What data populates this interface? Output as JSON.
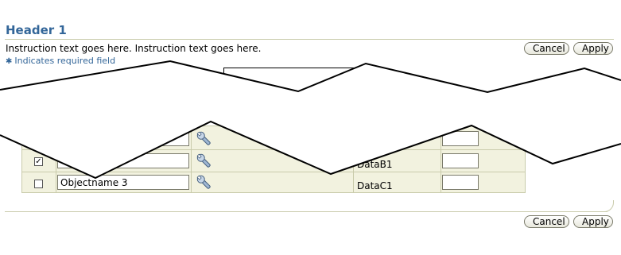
{
  "header": {
    "title": "Header 1",
    "instruction": "Instruction text goes here. Instruction text goes here.",
    "required_star": "✱",
    "required_text": "Indicates required field"
  },
  "buttons": {
    "cancel": "Cancel",
    "apply": "Apply"
  },
  "table": {
    "rows": [
      {
        "checked": false,
        "name": "",
        "data": ""
      },
      {
        "checked": true,
        "name": "",
        "data": "DataB1",
        "check_glyph": "✓"
      },
      {
        "checked": false,
        "name": "Objectname 3",
        "data": "DataC1"
      }
    ]
  },
  "icons": {
    "row_action": "wrench-icon"
  },
  "colors": {
    "header": "#336699",
    "table_bg": "#f2f2df",
    "rule": "#c9cbab"
  }
}
